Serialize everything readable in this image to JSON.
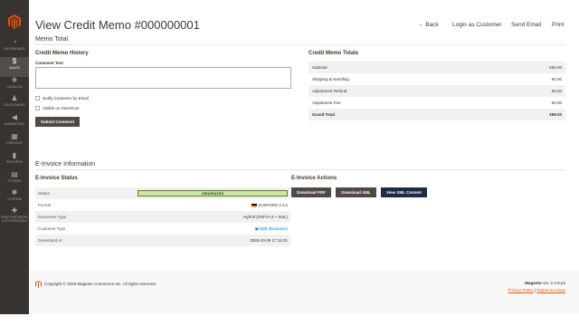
{
  "sidebar": {
    "items": [
      {
        "label": "DASHBOARD",
        "icon": "dashboard-icon",
        "glyph": "◔"
      },
      {
        "label": "SALES",
        "icon": "dollar-icon",
        "glyph": "$"
      },
      {
        "label": "CATALOG",
        "icon": "cube-icon",
        "glyph": "❖"
      },
      {
        "label": "CUSTOMERS",
        "icon": "person-icon",
        "glyph": "♟"
      },
      {
        "label": "MARKETING",
        "icon": "megaphone-icon",
        "glyph": "◀"
      },
      {
        "label": "CONTENT",
        "icon": "content-icon",
        "glyph": "▦"
      },
      {
        "label": "REPORTS",
        "icon": "bar-chart-icon",
        "glyph": "▮"
      },
      {
        "label": "STORES",
        "icon": "store-icon",
        "glyph": "▤"
      },
      {
        "label": "SYSTEM",
        "icon": "gear-icon",
        "glyph": "✱"
      },
      {
        "label": "FIND PARTNERS & EXTENSIONS",
        "icon": "puzzle-icon",
        "glyph": "✚"
      }
    ]
  },
  "header": {
    "title": "View Credit Memo #000000001",
    "back": "← Back",
    "login_as_customer": "Login as Customer",
    "send_email": "Send Email",
    "print": "Print"
  },
  "memo_total": {
    "section_title": "Memo Total",
    "history": {
      "title": "Credit Memo History",
      "comment_label": "Comment Text",
      "comment_value": "",
      "notify_label": "Notify Customer by Email",
      "visible_label": "Visible on Storefront",
      "submit": "Submit Comment"
    },
    "totals": {
      "title": "Credit Memo Totals",
      "rows": [
        {
          "label": "Subtotal",
          "value": "€69.00"
        },
        {
          "label": "Shipping & Handling",
          "value": "€0.00"
        },
        {
          "label": "Adjustment Refund",
          "value": "€0.00"
        },
        {
          "label": "Adjustment Fee",
          "value": "€0.00"
        },
        {
          "label": "Grand Total",
          "value": "€69.00"
        }
      ]
    }
  },
  "einvoice": {
    "section_title": "E-Invoice Information",
    "status_title": "E-Invoice Status",
    "actions_title": "E-Invoice Actions",
    "rows": [
      {
        "label": "Status",
        "value": "GENERATED"
      },
      {
        "label": "Format",
        "value": "ZUGFeRD 2.3.x"
      },
      {
        "label": "Document Type",
        "value": "Hybrid (PDF/A-3 + XML)"
      },
      {
        "label": "Customer Type",
        "value": "B2B (Business)"
      },
      {
        "label": "Generated At",
        "value": "2026-03-09 17:16:01"
      }
    ],
    "buttons": {
      "pdf": "Download PDF",
      "xml": "Download XML",
      "view": "View XML Content"
    },
    "status_color": "#d0e5a9"
  },
  "footer": {
    "copyright": "Copyright © 2026 Magento Commerce Inc. All rights reserved.",
    "brand": "Magento",
    "version": "ver. 2.4.8-p3",
    "privacy": "Privacy Policy",
    "report": "Report an Issue",
    "separator": "|"
  },
  "colors": {
    "sidebar": "#373330",
    "accent": "#eb5202",
    "dark_button": "#514943",
    "view_button": "#1f2a44"
  }
}
